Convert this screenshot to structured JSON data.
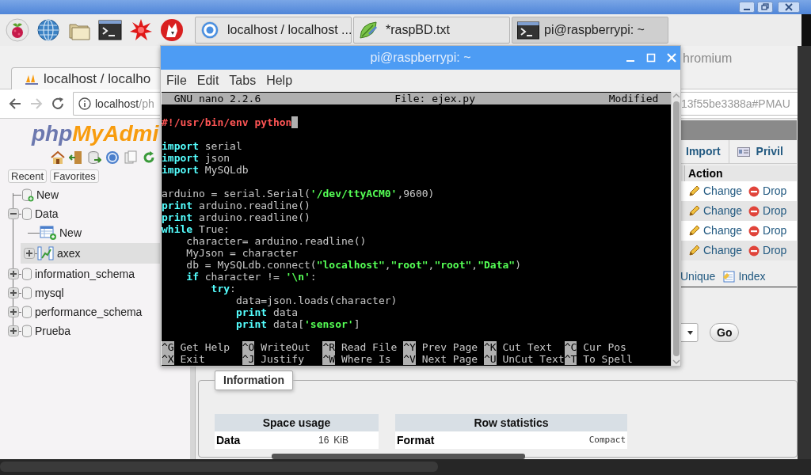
{
  "taskbar": {
    "tasks": [
      {
        "kind": "browser",
        "label": "localhost / localhost ...",
        "selected": false
      },
      {
        "kind": "editor",
        "label": "*raspBD.txt",
        "selected": false
      },
      {
        "kind": "terminal",
        "label": "pi@raspberrypi: ~",
        "selected": true
      }
    ]
  },
  "browser": {
    "title": "hromium",
    "tab": {
      "label": "localhost / localho"
    },
    "url": {
      "host": "localhost",
      "path_start": "/ph",
      "path_end": "13f55be3388a#PMAU"
    },
    "sidebar": {
      "logo_a": "php",
      "logo_b": "MyAdmi",
      "buttons": [
        "Recent",
        "Favorites"
      ],
      "tree": [
        {
          "kind": "new_db",
          "label": "New",
          "selected": false
        },
        {
          "kind": "db",
          "label": "Data",
          "expanded": true,
          "selected": false,
          "children": [
            {
              "kind": "new_table",
              "label": "New",
              "selected": false
            },
            {
              "kind": "table",
              "label": "axex",
              "expanded": false,
              "selected": true
            }
          ]
        },
        {
          "kind": "db",
          "label": "information_schema",
          "expanded": false,
          "selected": false
        },
        {
          "kind": "db",
          "label": "mysql",
          "expanded": false,
          "selected": false
        },
        {
          "kind": "db",
          "label": "performance_schema",
          "expanded": false,
          "selected": false
        },
        {
          "kind": "db",
          "label": "Prueba",
          "expanded": false,
          "selected": false
        }
      ]
    },
    "content": {
      "tabs": [
        "Import",
        "Privil"
      ],
      "action_header": "Action",
      "rows": [
        {
          "change": "Change",
          "drop": "Drop"
        },
        {
          "change": "Change",
          "drop": "Drop"
        },
        {
          "change": "Change",
          "drop": "Drop"
        },
        {
          "change": "Change",
          "drop": "Drop"
        }
      ],
      "index_actions": [
        "Unique",
        "Index"
      ],
      "go": "Go",
      "information": {
        "legend": "Information",
        "space_usage": {
          "title": "Space usage",
          "rows": [
            {
              "label": "Data",
              "value": "16",
              "unit": "KiB"
            }
          ]
        },
        "row_statistics": {
          "title": "Row statistics",
          "rows": [
            {
              "label": "Format",
              "value": "Compact"
            }
          ]
        }
      }
    }
  },
  "terminal": {
    "title": "pi@raspberrypi: ~",
    "menu": [
      "File",
      "Edit",
      "Tabs",
      "Help"
    ],
    "nano": {
      "version": "GNU nano 2.2.6",
      "file": "File: ejex.py",
      "status": "Modified"
    },
    "lines": [
      {
        "kind": "code",
        "segments": [
          {
            "kind": "comment",
            "text": "#!/usr/bin/env python"
          },
          {
            "kind": "cursor"
          }
        ]
      },
      {
        "kind": "blank"
      },
      {
        "kind": "code",
        "segments": [
          {
            "kind": "keyword",
            "text": "import"
          },
          {
            "kind": "plain",
            "text": " serial"
          }
        ]
      },
      {
        "kind": "code",
        "segments": [
          {
            "kind": "keyword",
            "text": "import"
          },
          {
            "kind": "plain",
            "text": " json"
          }
        ]
      },
      {
        "kind": "code",
        "segments": [
          {
            "kind": "keyword",
            "text": "import"
          },
          {
            "kind": "plain",
            "text": " MySQLdb"
          }
        ]
      },
      {
        "kind": "blank"
      },
      {
        "kind": "code",
        "segments": [
          {
            "kind": "plain",
            "text": "arduino = serial.Serial("
          },
          {
            "kind": "string",
            "text": "'/dev/ttyACM0'"
          },
          {
            "kind": "plain",
            "text": ",9600)"
          }
        ]
      },
      {
        "kind": "code",
        "segments": [
          {
            "kind": "keyword",
            "text": "print"
          },
          {
            "kind": "plain",
            "text": " arduino.readline()"
          }
        ]
      },
      {
        "kind": "code",
        "segments": [
          {
            "kind": "keyword",
            "text": "print"
          },
          {
            "kind": "plain",
            "text": " arduino.readline()"
          }
        ]
      },
      {
        "kind": "code",
        "segments": [
          {
            "kind": "keyword",
            "text": "while"
          },
          {
            "kind": "plain",
            "text": " True:"
          }
        ]
      },
      {
        "kind": "code",
        "segments": [
          {
            "kind": "plain",
            "text": "    character= arduino.readline()"
          }
        ]
      },
      {
        "kind": "code",
        "segments": [
          {
            "kind": "plain",
            "text": "    MyJson = character"
          }
        ]
      },
      {
        "kind": "code",
        "segments": [
          {
            "kind": "plain",
            "text": "    db = MySQLdb.connect("
          },
          {
            "kind": "string",
            "text": "\"localhost\""
          },
          {
            "kind": "plain",
            "text": ","
          },
          {
            "kind": "string",
            "text": "\"root\""
          },
          {
            "kind": "plain",
            "text": ","
          },
          {
            "kind": "string",
            "text": "\"root\""
          },
          {
            "kind": "plain",
            "text": ","
          },
          {
            "kind": "string",
            "text": "\"Data\""
          },
          {
            "kind": "plain",
            "text": ")"
          }
        ]
      },
      {
        "kind": "code",
        "segments": [
          {
            "kind": "keyword",
            "text": "    if"
          },
          {
            "kind": "plain",
            "text": " character != "
          },
          {
            "kind": "string",
            "text": "'\\n'"
          },
          {
            "kind": "plain",
            "text": ":"
          }
        ]
      },
      {
        "kind": "code",
        "segments": [
          {
            "kind": "keyword",
            "text": "        try"
          },
          {
            "kind": "plain",
            "text": ":"
          }
        ]
      },
      {
        "kind": "code",
        "segments": [
          {
            "kind": "plain",
            "text": "            data=json.loads(character)"
          }
        ]
      },
      {
        "kind": "code",
        "segments": [
          {
            "kind": "keyword",
            "text": "            print"
          },
          {
            "kind": "plain",
            "text": " data"
          }
        ]
      },
      {
        "kind": "code",
        "segments": [
          {
            "kind": "keyword",
            "text": "            print"
          },
          {
            "kind": "plain",
            "text": " data["
          },
          {
            "kind": "string",
            "text": "'sensor'"
          },
          {
            "kind": "plain",
            "text": "]"
          }
        ]
      }
    ],
    "shortcuts": [
      {
        "key": "^G",
        "label": "Get Help"
      },
      {
        "key": "^O",
        "label": "WriteOut"
      },
      {
        "key": "^R",
        "label": "Read File"
      },
      {
        "key": "^Y",
        "label": "Prev Page"
      },
      {
        "key": "^K",
        "label": "Cut Text"
      },
      {
        "key": "^C",
        "label": "Cur Pos"
      },
      {
        "key": "^X",
        "label": "Exit"
      },
      {
        "key": "^J",
        "label": "Justify"
      },
      {
        "key": "^W",
        "label": "Where Is"
      },
      {
        "key": "^V",
        "label": "Next Page"
      },
      {
        "key": "^U",
        "label": "UnCut Text"
      },
      {
        "key": "^T",
        "label": "To Spell"
      }
    ]
  }
}
